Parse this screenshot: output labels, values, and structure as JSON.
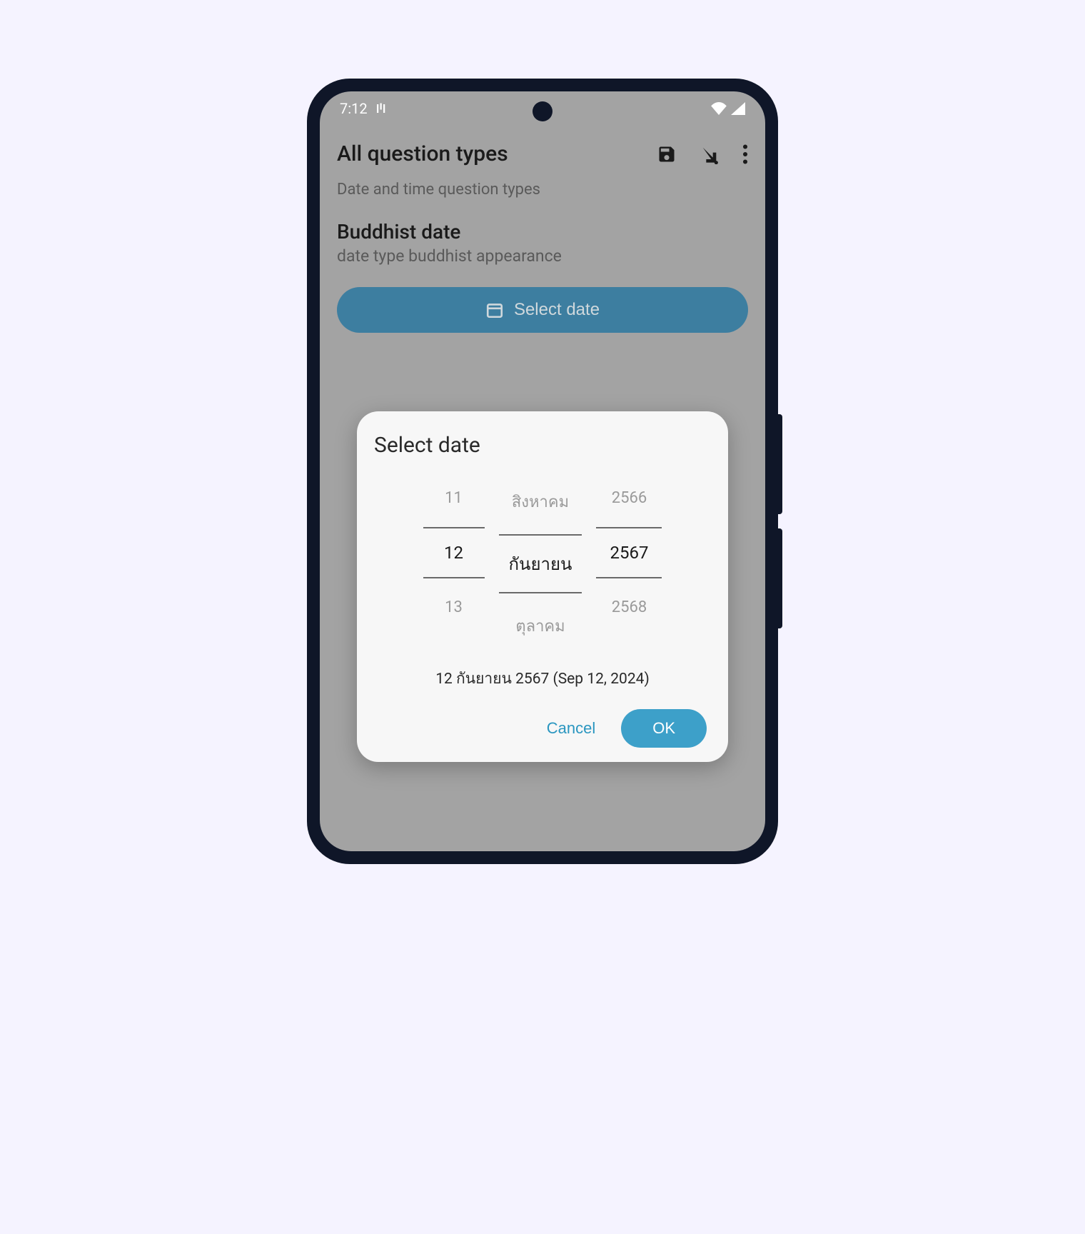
{
  "status": {
    "time": "7:12"
  },
  "appbar": {
    "title": "All question types"
  },
  "section": {
    "subtitle": "Date and time question types",
    "title": "Buddhist date",
    "description": "date type buddhist appearance"
  },
  "button": {
    "select_date": "Select date"
  },
  "dialog": {
    "title": "Select date",
    "picker": {
      "day": {
        "prev": "11",
        "sel": "12",
        "next": "13"
      },
      "month": {
        "prev": "สิงหาคม",
        "sel": "กันยายน",
        "next": "ตุลาคม"
      },
      "year": {
        "prev": "2566",
        "sel": "2567",
        "next": "2568"
      }
    },
    "summary": "12 กันยายน 2567 (Sep 12, 2024)",
    "cancel": "Cancel",
    "ok": "OK"
  }
}
